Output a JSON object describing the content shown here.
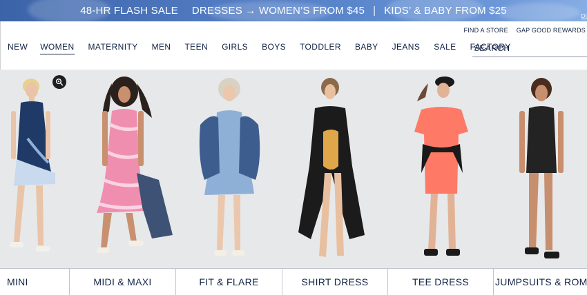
{
  "promo": {
    "segments": [
      "48-HR FLASH SALE",
      "DRESSES → WOMEN’S FROM $45",
      "KIDS’ & BABY FROM $25"
    ],
    "separator": "|",
    "details_label": "DI"
  },
  "utility": {
    "find_store": "FIND A STORE",
    "rewards": "GAP GOOD REWARDS"
  },
  "nav": {
    "items": [
      "NEW",
      "WOMEN",
      "MATERNITY",
      "MEN",
      "TEEN",
      "GIRLS",
      "BOYS",
      "TODDLER",
      "BABY",
      "JEANS",
      "SALE",
      "FACTORY"
    ],
    "active": "WOMEN"
  },
  "search": {
    "placeholder": "SEARCH"
  },
  "hero": {
    "icons": {
      "zoom": "zoom-search-icon"
    }
  },
  "categories": [
    "MINI",
    "MIDI & MAXI",
    "FIT & FLARE",
    "SHIRT DRESS",
    "TEE DRESS",
    "JUMPSUITS & ROMPERS"
  ],
  "colors": {
    "navy": "#122344",
    "promo_start": "#3b63a8",
    "promo_end": "#86aee4",
    "hero_bg": "#e7e8ea"
  }
}
